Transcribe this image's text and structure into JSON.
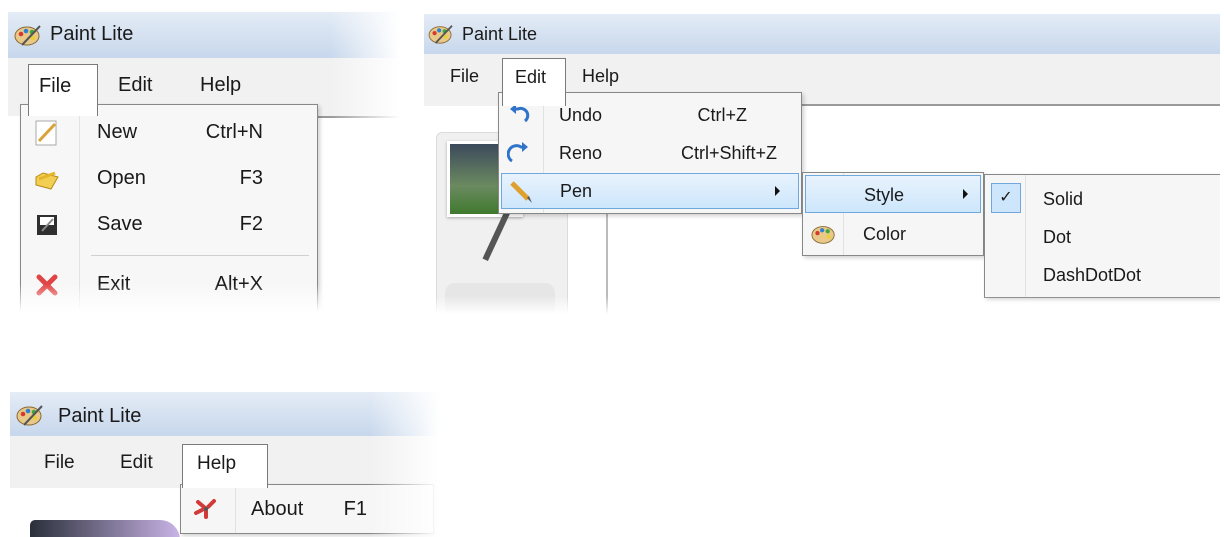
{
  "app_title": "Paint Lite",
  "panels": {
    "file_panel": {
      "menubar": [
        {
          "label": "File",
          "open": true
        },
        {
          "label": "Edit"
        },
        {
          "label": "Help"
        }
      ],
      "file_menu": [
        {
          "label": "New",
          "shortcut": "Ctrl+N",
          "icon": "new-document-icon"
        },
        {
          "label": "Open",
          "shortcut": "F3",
          "icon": "open-folder-icon"
        },
        {
          "label": "Save",
          "shortcut": "F2",
          "icon": "save-disk-icon"
        },
        {
          "label": "Exit",
          "shortcut": "Alt+X",
          "icon": "exit-x-icon"
        }
      ]
    },
    "edit_panel": {
      "menubar": [
        {
          "label": "File"
        },
        {
          "label": "Edit",
          "open": true
        },
        {
          "label": "Help"
        }
      ],
      "edit_menu": [
        {
          "label": "Undo",
          "shortcut": "Ctrl+Z",
          "icon": "undo-icon"
        },
        {
          "label": "Reno",
          "shortcut": "Ctrl+Shift+Z",
          "icon": "redo-icon"
        },
        {
          "label": "Pen",
          "icon": "pencil-icon",
          "has_submenu": true,
          "highlighted": true
        }
      ],
      "pen_submenu": [
        {
          "label": "Style",
          "has_submenu": true,
          "highlighted": true
        },
        {
          "label": "Color",
          "icon": "palette-icon"
        }
      ],
      "style_submenu": [
        {
          "label": "Solid",
          "checked": true
        },
        {
          "label": "Dot"
        },
        {
          "label": "DashDotDot"
        }
      ],
      "checkmark": "✓"
    },
    "help_panel": {
      "menubar": [
        {
          "label": "File"
        },
        {
          "label": "Edit"
        },
        {
          "label": "Help",
          "open": true
        }
      ],
      "help_menu": [
        {
          "label": "About",
          "shortcut": "F1",
          "icon": "about-icon"
        }
      ]
    }
  },
  "colors": {
    "titlebar_top": "#e4ecf6",
    "titlebar_bottom": "#c7d7ec",
    "highlight_border": "#6fa8dc",
    "highlight_fill": "#cde6fb"
  }
}
